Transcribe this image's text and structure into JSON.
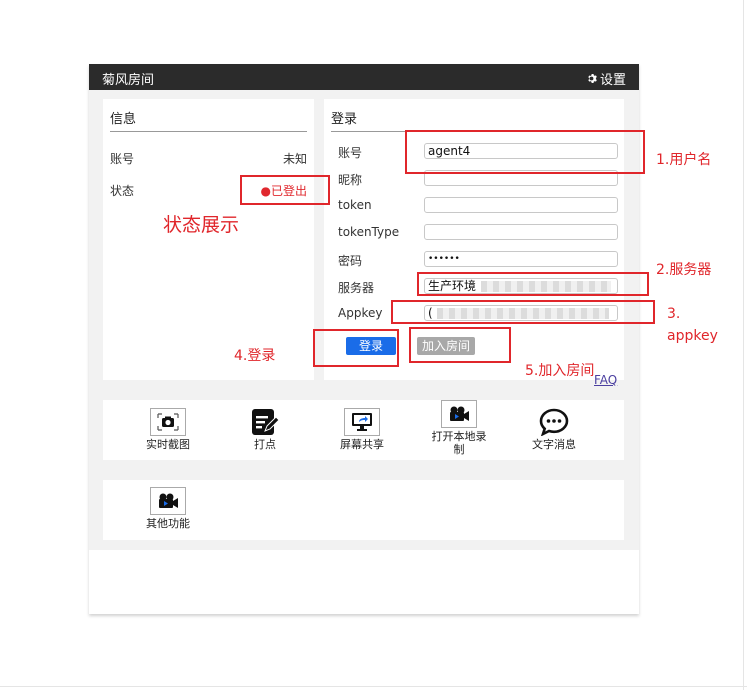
{
  "window": {
    "title": "菊风房间",
    "settings_label": "设置"
  },
  "info": {
    "title": "信息",
    "account_label": "账号",
    "account_value": "未知",
    "status_label": "状态",
    "status_value": "●已登出"
  },
  "login": {
    "title": "登录",
    "fields": {
      "account": {
        "label": "账号",
        "value": "agent4"
      },
      "nickname": {
        "label": "昵称",
        "value": ""
      },
      "token": {
        "label": "token",
        "value": ""
      },
      "tokenType": {
        "label": "tokenType",
        "value": ""
      },
      "password": {
        "label": "密码",
        "value": "••••••"
      },
      "server": {
        "label": "服务器",
        "value": "生产环境"
      },
      "appkey": {
        "label": "Appkey",
        "value": "("
      }
    },
    "login_button": "登录",
    "join_button": "加入房间",
    "faq": "FAQ"
  },
  "toolbar": {
    "items": [
      {
        "label": "实时截图",
        "icon": "camera-icon"
      },
      {
        "label": "打点",
        "icon": "edit-note-icon"
      },
      {
        "label": "屏幕共享",
        "icon": "screen-share-icon"
      },
      {
        "label": "打开本地录\n制",
        "icon": "video-record-icon"
      },
      {
        "label": "文字消息",
        "icon": "chat-bubble-icon"
      }
    ],
    "other": {
      "label": "其他功能",
      "icon": "video-record-icon"
    }
  },
  "annotations": {
    "username": "1.用户名",
    "server": "2.服务器",
    "appkey_num": "3.",
    "appkey": "appkey",
    "login": "4.登录",
    "join": "5.加入房间",
    "status": "状态展示"
  },
  "colors": {
    "annotation": "#e0262b",
    "login_button": "#1a6ce8",
    "titlebar": "#2b2b2b"
  }
}
